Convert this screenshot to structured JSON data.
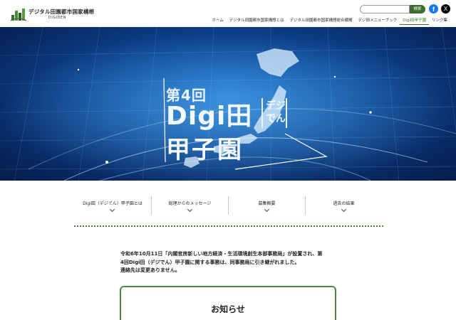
{
  "header": {
    "logo_title": "デジタル田園都市国家構想",
    "logo_sub": "DIGIDEN",
    "search": {
      "placeholder": "",
      "button_label": "検索"
    },
    "social": {
      "facebook": "f",
      "x": "X"
    },
    "nav": [
      {
        "label": "ホーム",
        "active": false
      },
      {
        "label": "デジタル田園都市国家構想とは",
        "active": false
      },
      {
        "label": "デジタル田園都市国家構想総合戦略",
        "active": false
      },
      {
        "label": "デジ田メニューブック",
        "active": false
      },
      {
        "label": "Digi田甲子園",
        "active": true
      },
      {
        "label": "リンク集",
        "active": false
      }
    ]
  },
  "hero": {
    "num": "第4回",
    "main": "Digi田",
    "ruby_top": "デジ",
    "ruby_bottom": "でん",
    "sub": "甲子園"
  },
  "subnav": [
    {
      "label": "Digi田（デジでん）甲子園とは"
    },
    {
      "label": "総理からのメッセージ"
    },
    {
      "label": "募集概要"
    },
    {
      "label": "過去の結果"
    }
  ],
  "notice": {
    "line1": "令和6年10月11日「内閣官房新しい地方経済・生活環境創生本部事務局」が設置され、第",
    "line2": "4回Digi田（デジでん）甲子園に関する事務は、同事務局に引き継がれました。",
    "line3": "連絡先は変更ありません。"
  },
  "news": {
    "title": "お知らせ"
  },
  "colors": {
    "accent": "#3b6d2e",
    "hero_bg": "#0f4e9e"
  }
}
